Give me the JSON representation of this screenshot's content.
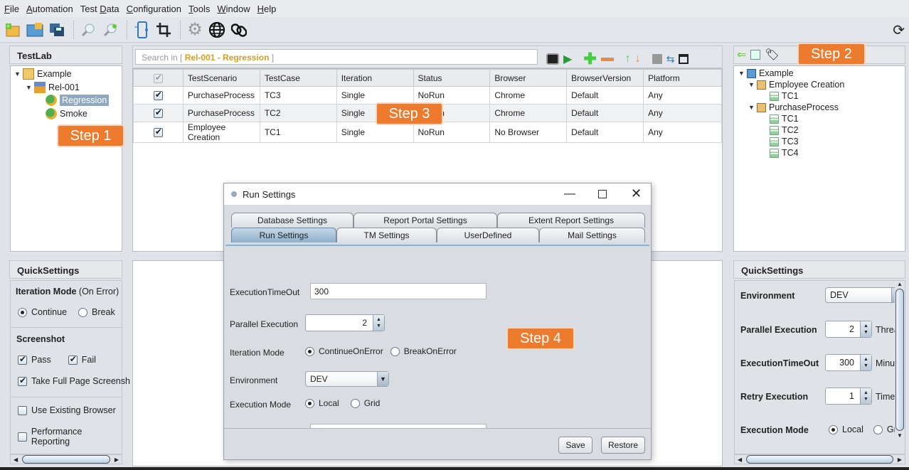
{
  "menu": [
    {
      "prefix": "",
      "ul": "F",
      "rest": "ile"
    },
    {
      "prefix": "",
      "ul": "A",
      "rest": "utomation"
    },
    {
      "prefix": "Test ",
      "ul": "D",
      "rest": "ata"
    },
    {
      "prefix": "",
      "ul": "C",
      "rest": "onfiguration"
    },
    {
      "prefix": "",
      "ul": "T",
      "rest": "ools"
    },
    {
      "prefix": "",
      "ul": "W",
      "rest": "indow"
    },
    {
      "prefix": "",
      "ul": "H",
      "rest": "elp"
    }
  ],
  "toolbar_icons": [
    "new-project-icon",
    "open-project-icon",
    "save-project-icon",
    "find-icon",
    "find-replace-icon",
    "mobile-icon",
    "crop-icon",
    "settings-icon",
    "browser-globe-icon",
    "link-icon",
    "refresh-icon"
  ],
  "testlab": {
    "title": "TestLab",
    "tree": {
      "root": "Example",
      "release": "Rel-001",
      "sets": [
        "Regression",
        "Smoke"
      ],
      "selected": "Regression"
    }
  },
  "steps": {
    "s1": "Step 1",
    "s2": "Step 2",
    "s3": "Step 3",
    "s4": "Step 4"
  },
  "search": {
    "prefix": "Search in [ ",
    "context": "Rel-001 - Regression",
    "suffix": " ]"
  },
  "table": {
    "headers": [
      "",
      "TestScenario",
      "TestCase",
      "Iteration",
      "Status",
      "Browser",
      "BrowserVersion",
      "Platform"
    ],
    "rows": [
      {
        "checked": true,
        "scenario": "PurchaseProcess",
        "testcase": "TC3",
        "iteration": "Single",
        "status": "NoRun",
        "browser": "Chrome",
        "version": "Default",
        "platform": "Any"
      },
      {
        "checked": true,
        "scenario": "PurchaseProcess",
        "testcase": "TC2",
        "iteration": "Single",
        "status": "NoRun",
        "browser": "Chrome",
        "version": "Default",
        "platform": "Any"
      },
      {
        "checked": true,
        "scenario": "Employee Creation",
        "testcase": "TC1",
        "iteration": "Single",
        "status": "NoRun",
        "browser": "No Browser",
        "version": "Default",
        "platform": "Any"
      }
    ]
  },
  "testplan": {
    "root": "Example",
    "scenarios": [
      {
        "name": "Employee Creation",
        "cases": [
          "TC1"
        ]
      },
      {
        "name": "PurchaseProcess",
        "cases": [
          "TC1",
          "TC2",
          "TC3",
          "TC4"
        ]
      }
    ]
  },
  "left_qs": {
    "title": "QuickSettings",
    "iteration_label": "Iteration Mode",
    "iteration_hint": "(On Error)",
    "continue": "Continue",
    "break": "Break",
    "iteration_value": "Continue",
    "screenshot_label": "Screenshot",
    "pass": "Pass",
    "pass_checked": true,
    "fail": "Fail",
    "fail_checked": true,
    "fullpage": "Take Full Page Screensh",
    "fullpage_checked": true,
    "existing": "Use Existing Browser",
    "existing_checked": false,
    "perf": "Performance Reporting",
    "perf_checked": false
  },
  "right_qs": {
    "title": "QuickSettings",
    "env_label": "Environment",
    "env_value": "DEV",
    "par_label": "Parallel Execution",
    "par_value": "2",
    "par_unit": "Threa",
    "timeout_label": "ExecutionTimeOut",
    "timeout_value": "300",
    "timeout_unit": "Minut",
    "retry_label": "Retry Execution",
    "retry_value": "1",
    "retry_unit": "Times",
    "mode_label": "Execution Mode",
    "local": "Local",
    "grid": "Gri",
    "mode_value": "Local"
  },
  "dialog": {
    "title": "Run Settings",
    "tabs_top": [
      "Database Settings",
      "Report Portal Settings",
      "Extent Report Settings"
    ],
    "tabs_bottom": [
      "Run Settings",
      "TM Settings",
      "UserDefined",
      "Mail Settings"
    ],
    "active_tab": "Run Settings",
    "timeout_label": "ExecutionTimeOut",
    "timeout_value": "300",
    "parallel_label": "Parallel Execution",
    "parallel_value": "2",
    "iter_label": "Iteration Mode",
    "iter_continue": "ContinueOnError",
    "iter_break": "BreakOnError",
    "iter_value": "ContinueOnError",
    "env_label": "Environment",
    "env_value": "DEV",
    "mode_label": "Execution Mode",
    "mode_local": "Local",
    "mode_grid": "Grid",
    "mode_value": "Local",
    "save": "Save",
    "restore": "Restore"
  }
}
